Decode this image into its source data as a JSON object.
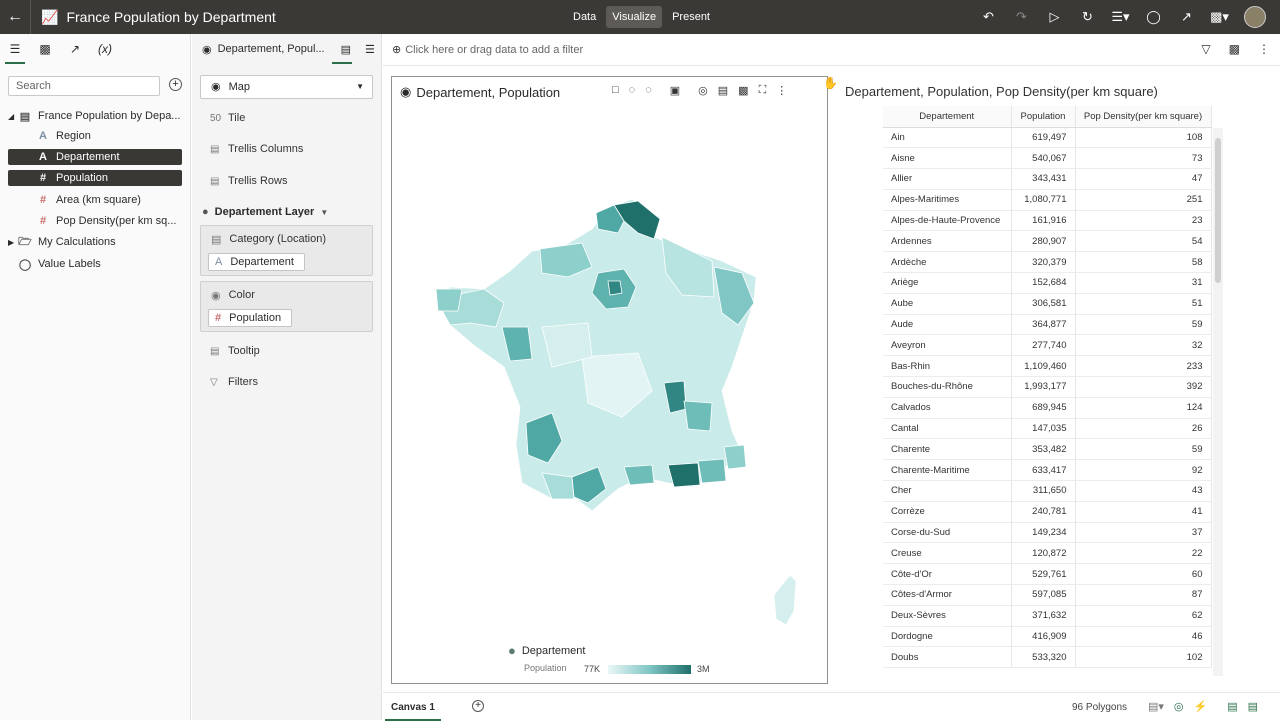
{
  "header": {
    "title": "France Population by Department",
    "modes": [
      "Data",
      "Visualize",
      "Present"
    ],
    "active_mode": "Visualize"
  },
  "data_panel": {
    "search_placeholder": "Search",
    "tree": {
      "dataset": "France Population by Depa...",
      "fields": [
        {
          "label": "Region",
          "type": "A"
        },
        {
          "label": "Departement",
          "type": "A",
          "selected": true
        },
        {
          "label": "Population",
          "type": "#",
          "selected": true
        },
        {
          "label": "Area (km square)",
          "type": "#"
        },
        {
          "label": "Pop Density(per km sq...",
          "type": "#"
        }
      ],
      "my_calculations": "My Calculations",
      "value_labels": "Value Labels"
    }
  },
  "grammar_panel": {
    "tab_label": "Departement, Popul...",
    "viz_type": "Map",
    "tile": "Tile",
    "trellis_columns": "Trellis Columns",
    "trellis_rows": "Trellis Rows",
    "layer": "Departement Layer",
    "category_label": "Category (Location)",
    "category_value": "Departement",
    "color_label": "Color",
    "color_value": "Population",
    "tooltip": "Tooltip",
    "filters": "Filters"
  },
  "filter_bar": {
    "placeholder": "Click here or drag data to add a filter"
  },
  "map_viz": {
    "title": "Departement, Population",
    "legend_name": "Departement",
    "legend_measure": "Population",
    "legend_min": "77K",
    "legend_max": "3M",
    "colors": {
      "low": "#eaf7f7",
      "mid": "#7fc6c4",
      "high": "#1f6f6a"
    }
  },
  "table_viz": {
    "title": "Departement, Population, Pop Density(per km square)",
    "columns": [
      "Departement",
      "Population",
      "Pop Density(per km square)"
    ],
    "rows": [
      [
        "Ain",
        "619,497",
        "108"
      ],
      [
        "Aisne",
        "540,067",
        "73"
      ],
      [
        "Allier",
        "343,431",
        "47"
      ],
      [
        "Alpes-Maritimes",
        "1,080,771",
        "251"
      ],
      [
        "Alpes-de-Haute-Provence",
        "161,916",
        "23"
      ],
      [
        "Ardennes",
        "280,907",
        "54"
      ],
      [
        "Ardèche",
        "320,379",
        "58"
      ],
      [
        "Ariège",
        "152,684",
        "31"
      ],
      [
        "Aube",
        "306,581",
        "51"
      ],
      [
        "Aude",
        "364,877",
        "59"
      ],
      [
        "Aveyron",
        "277,740",
        "32"
      ],
      [
        "Bas-Rhin",
        "1,109,460",
        "233"
      ],
      [
        "Bouches-du-Rhône",
        "1,993,177",
        "392"
      ],
      [
        "Calvados",
        "689,945",
        "124"
      ],
      [
        "Cantal",
        "147,035",
        "26"
      ],
      [
        "Charente",
        "353,482",
        "59"
      ],
      [
        "Charente-Maritime",
        "633,417",
        "92"
      ],
      [
        "Cher",
        "311,650",
        "43"
      ],
      [
        "Corrèze",
        "240,781",
        "41"
      ],
      [
        "Corse-du-Sud",
        "149,234",
        "37"
      ],
      [
        "Creuse",
        "120,872",
        "22"
      ],
      [
        "Côte-d'Or",
        "529,761",
        "60"
      ],
      [
        "Côtes-d'Armor",
        "597,085",
        "87"
      ],
      [
        "Deux-Sèvres",
        "371,632",
        "62"
      ],
      [
        "Dordogne",
        "416,909",
        "46"
      ],
      [
        "Doubs",
        "533,320",
        "102"
      ]
    ]
  },
  "footer": {
    "canvas_tab": "Canvas 1",
    "status": "96 Polygons"
  }
}
